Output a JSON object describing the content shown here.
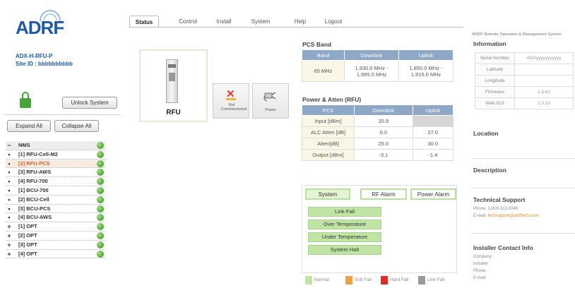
{
  "brand": {
    "logo_text": "ADRF",
    "device_name": "ADX-H-RFU-P",
    "site_id": "Site ID : bbbbbbbbbb"
  },
  "left": {
    "unlock_label": "Unlock System",
    "expand_label": "Expand All",
    "collapse_label": "Collapse All"
  },
  "tree": [
    {
      "sign": "−",
      "label": "NMS",
      "status": "green"
    },
    {
      "sign": "•",
      "label": "[1] RFU-Cell-M2",
      "status": "green"
    },
    {
      "sign": "•",
      "label": "[2] RFU-PCS",
      "status": "green",
      "selected": true
    },
    {
      "sign": "•",
      "label": "[3] RFU-AWS",
      "status": "green"
    },
    {
      "sign": "•",
      "label": "[4] RFU-700",
      "status": "green"
    },
    {
      "sign": "•",
      "label": "[1] BCU-700",
      "status": "green"
    },
    {
      "sign": "•",
      "label": "[2] BCU-Cell",
      "status": "green"
    },
    {
      "sign": "•",
      "label": "[3] BCU-PCS",
      "status": "green"
    },
    {
      "sign": "•",
      "label": "[4] BCU-AWS",
      "status": "green"
    },
    {
      "sign": "+",
      "label": "[1] OPT",
      "status": "green"
    },
    {
      "sign": "+",
      "label": "[2] OPT",
      "status": "green"
    },
    {
      "sign": "+",
      "label": "[3] OPT",
      "status": "green"
    },
    {
      "sign": "+",
      "label": "[4] OPT",
      "status": "green"
    }
  ],
  "tabs": [
    "Status",
    "Control",
    "Install",
    "System",
    "Help",
    "Logout"
  ],
  "device": {
    "name": "RFU",
    "not_commissioned": "Not Commissioned",
    "power": "Power"
  },
  "pcs_band": {
    "title": "PCS Band",
    "headers": [
      "Band",
      "Downlink",
      "Uplink"
    ],
    "band": "65 MHz",
    "downlink": [
      "1,930.0 MHz -",
      "1,995.0 MHz"
    ],
    "uplink": [
      "1,850.0 MHz -",
      "1,915.0 MHz"
    ]
  },
  "power_atten": {
    "title": "Power & Atten (RFU)",
    "headers": [
      "PCS",
      "Downlink",
      "Uplink"
    ],
    "rows": [
      {
        "label": "Input [dBm]",
        "dl": "20.9",
        "ul": ""
      },
      {
        "label": "ALC Atten [dB]",
        "dl": "0.0",
        "ul": "27.0"
      },
      {
        "label": "Atten[dB]",
        "dl": "25.0",
        "ul": "30.0"
      },
      {
        "label": "Output [dBm]",
        "dl": "-3.1",
        "ul": "-1.4"
      }
    ]
  },
  "alarm": {
    "tabs": [
      "System",
      "RF Alarm",
      "Power Alarm"
    ],
    "items": [
      "Link Fail",
      "Over Temperature",
      "Under Temperature",
      "System Halt"
    ]
  },
  "legend": [
    {
      "label": "Normal",
      "color": "#bfe4a4"
    },
    {
      "label": "Soft Fail",
      "color": "#f0a04a"
    },
    {
      "label": "Hard Fail",
      "color": "#e02a2a"
    },
    {
      "label": "Link Fail",
      "color": "#9a9a9a"
    }
  ],
  "right": {
    "system_title": "ADRF Remote Operation & Management System",
    "info_title": "Information",
    "info": [
      {
        "k": "Serial Number",
        "v": "ADXyyyyyyyyyyy"
      },
      {
        "k": "Latitude",
        "v": ""
      },
      {
        "k": "Longitude",
        "v": ""
      },
      {
        "k": "Firmware",
        "v": "1.5.62"
      },
      {
        "k": "Web GUI",
        "v": "1.0.10"
      }
    ],
    "location": "Location",
    "description": "Description",
    "tech_title": "Technical Support",
    "phone": "Phone: 1-800-313-9345",
    "email_label": "E-mail:",
    "email": "techsupport@adrftech.com",
    "installer_title": "Installer Contact Info",
    "installer_lines": [
      "Company:",
      "Installer:",
      "Phone:",
      "E-mail:"
    ]
  },
  "colors": {
    "accent": "#1f5aa8",
    "header": "#8fa8c7",
    "normal": "#bfe4a4",
    "led": "#2e8a1f",
    "selected": "#e0622a"
  }
}
